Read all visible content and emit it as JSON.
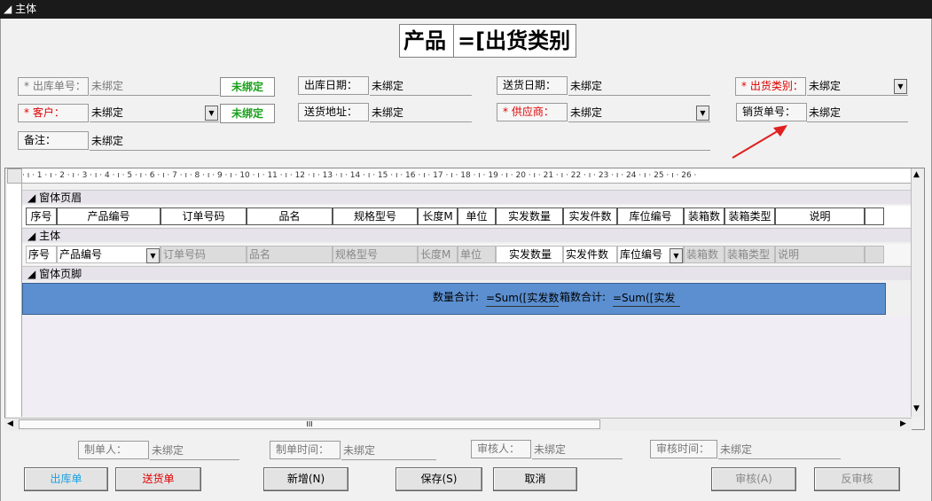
{
  "section": {
    "label": "主体"
  },
  "title": {
    "prefix": "产品",
    "expr": "=[出货类别"
  },
  "fields": {
    "unbound": "未绑定",
    "outbound_no": "* 出库单号：",
    "outbound_date": "出库日期：",
    "delivery_date": "送货日期：",
    "ship_type": "* 出货类别：",
    "customer": "* 客户：",
    "delivery_addr": "送货地址：",
    "supplier": "* 供应商：",
    "sales_no": "销货单号：",
    "remark": "备注："
  },
  "bound_btn": "未绑定",
  "subform": {
    "ruler": "· ı · 1 · ı · 2 · ı · 3 · ı · 4 · ı · 5 · ı · 6 · ı · 7 · ı · 8 · ı · 9 · ı · 10 · ı · 11 · ı · 12 · ı · 13 · ı · 14 · ı · 15 · ı · 16 · ı · 17 · ı · 18 · ı · 19 · ı · 20 · ı · 21 · ı · 22 · ı · 23 · ı · 24 · ı · 25 · ı · 26 ·",
    "header_band": "窗体页眉",
    "detail_band": "主体",
    "footer_band": "窗体页脚",
    "columns": [
      "序号",
      "产品编号",
      "订单号码",
      "品名",
      "规格型号",
      "长度M",
      "单位",
      "实发数量",
      "实发件数",
      "库位编号",
      "装箱数",
      "装箱类型",
      "说明"
    ],
    "detail": [
      "序号",
      "产品编号",
      "订单号码",
      "品名",
      "规格型号",
      "长度M",
      "单位",
      "实发数量",
      "实发件数",
      "库位编号",
      "装箱数",
      "装箱类型",
      "说明"
    ],
    "qty_total_label": "数量合计:",
    "qty_total_expr": "=Sum([实发数",
    "box_total_label": "箱数合计:",
    "box_total_expr": "=Sum([实发",
    "hscroll_mark": "III"
  },
  "bottom": {
    "maker": "制单人：",
    "make_time": "制单时间：",
    "auditor": "审核人：",
    "audit_time": "审核时间："
  },
  "buttons": {
    "outbound": "出库单",
    "delivery": "送货单",
    "new": "新增(N)",
    "save": "保存(S)",
    "cancel": "取消",
    "audit": "审核(A)",
    "unaudit": "反审核"
  },
  "colors": {
    "accent_red": "#e00000",
    "green": "#1aa01a",
    "footer_blue": "#5b8fd0",
    "cyan": "#1aa0e0",
    "arrow_red": "#e02020"
  }
}
